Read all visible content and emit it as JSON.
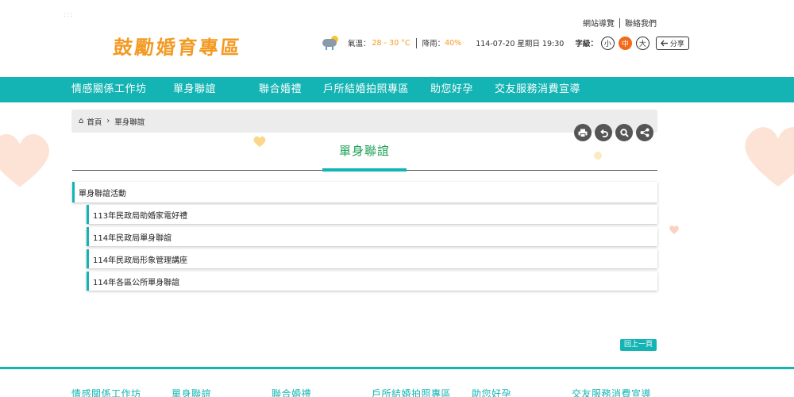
{
  "header": {
    "dots": ":::",
    "logo_text": "鼓勵婚育專區",
    "top_links": [
      "網站導覽",
      "聯絡我們"
    ],
    "weather": {
      "temp_label": "氣溫：",
      "temp_value": "28 - 30 °C",
      "rain_label": "降雨：",
      "rain_value": "40%"
    },
    "date": "114-07-20 星期日 19:30",
    "font_size": {
      "label": "字級：",
      "small": "小",
      "medium": "中",
      "large": "大"
    },
    "share_label": "分享"
  },
  "nav": {
    "items": [
      "情感關係工作坊",
      "單身聯誼",
      "聯合婚禮",
      "戶所結婚拍照專區",
      "助您好孕",
      "交友服務消費宣導"
    ]
  },
  "breadcrumb": {
    "home": "首頁",
    "current": "單身聯誼"
  },
  "tools": {
    "print": "print-icon",
    "back": "back-icon",
    "search": "search-icon",
    "share": "share-icon"
  },
  "page_title": "單身聯誼",
  "list": {
    "category": "單身聯誼活動",
    "items": [
      "113年民政局助婚家電好禮",
      "114年民政局單身聯誼",
      "114年民政局形象管理講座",
      "114年各區公所單身聯誼"
    ]
  },
  "back_button": "回上一頁",
  "footer": {
    "items": [
      "情感關係工作坊",
      "單身聯誼",
      "聯合婚禮",
      "戶所結婚拍照專區",
      "助您好孕",
      "交友服務消費宣導"
    ]
  },
  "colors": {
    "accent": "#14b4b4",
    "logo": "#f39a23",
    "title": "#1a9f55"
  }
}
